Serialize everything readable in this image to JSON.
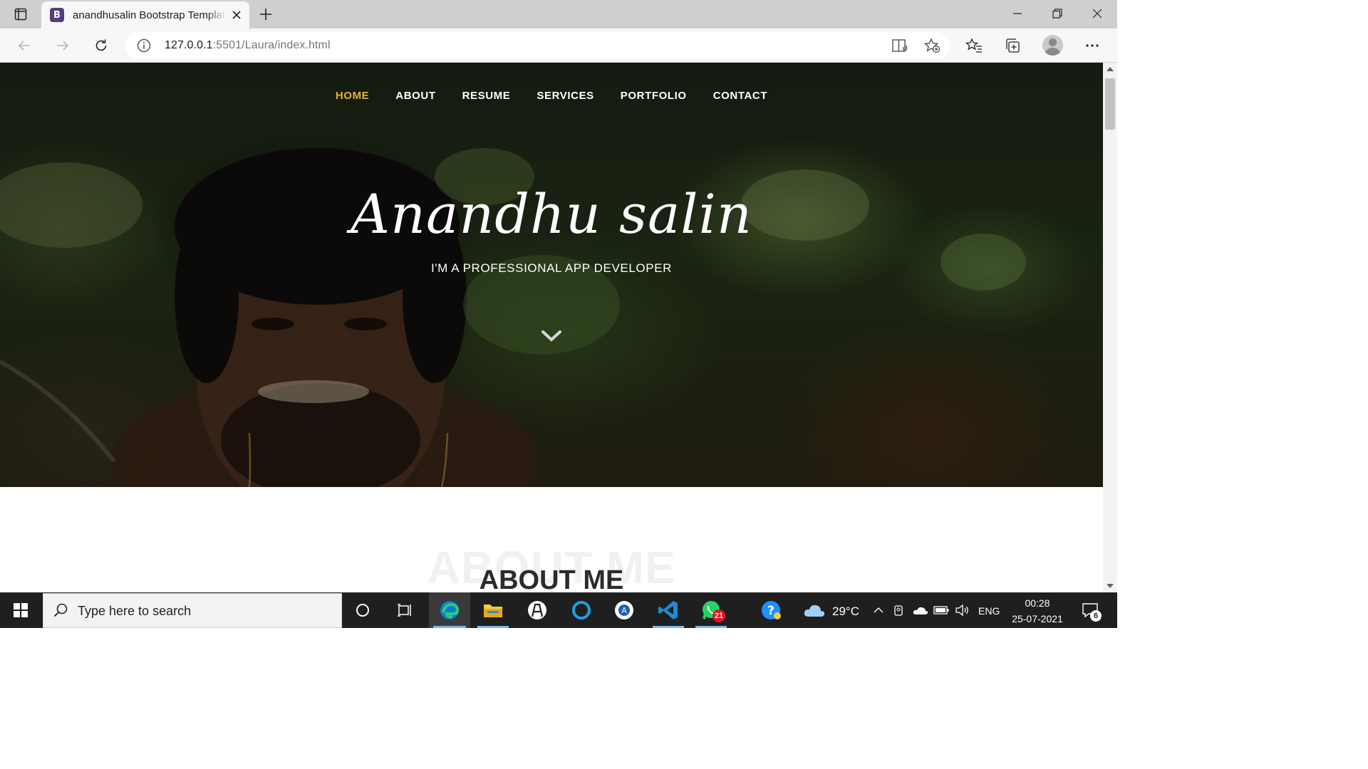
{
  "browser": {
    "tab": {
      "favicon_letter": "B",
      "title": "anandhusalin Bootstrap Template"
    },
    "url": {
      "host": "127.0.0.1",
      "path": ":5501/Laura/index.html"
    }
  },
  "site": {
    "nav": [
      {
        "label": "HOME",
        "active": true
      },
      {
        "label": "ABOUT"
      },
      {
        "label": "RESUME"
      },
      {
        "label": "SERVICES"
      },
      {
        "label": "PORTFOLIO"
      },
      {
        "label": "CONTACT"
      }
    ],
    "hero": {
      "name": "Anandhu salin",
      "subtitle": "I'M A PROFESSIONAL APP DEVELOPER"
    },
    "about": {
      "watermark": "ABOUT ME",
      "title": "ABOUT ME"
    },
    "accent_color": "#e9b22a"
  },
  "taskbar": {
    "search_placeholder": "Type here to search",
    "apps": [
      "cortana-icon",
      "task-view-icon",
      "edge-icon",
      "file-explorer-icon",
      "unknown-app-icon",
      "cortana-circle-icon",
      "app-icon",
      "vscode-icon",
      "whatsapp-icon",
      "help-icon"
    ],
    "whatsapp_badge": "21",
    "weather": "29°C",
    "language": "ENG",
    "time": "00:28",
    "date": "25-07-2021",
    "notifications": "6"
  }
}
